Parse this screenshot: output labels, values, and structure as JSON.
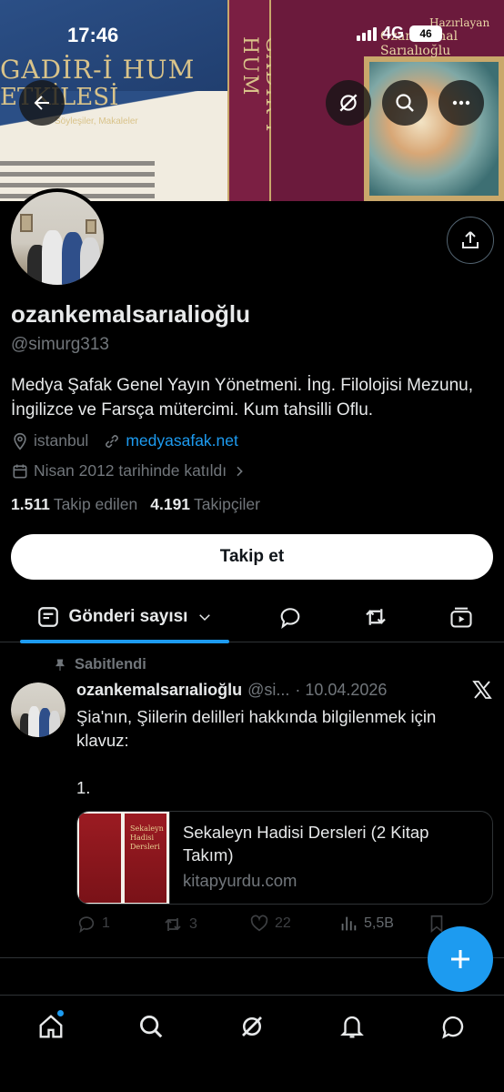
{
  "status_bar": {
    "time": "17:46",
    "network": "4G",
    "battery": "46"
  },
  "banner": {
    "title_line1": "GADİR-İ HUM",
    "title_line2": "ETKİLESİ",
    "subtitle": "Söyleşiler, Makaleler",
    "spine_text": "GADİR-İ HUM",
    "hazirlayan": "Hazırlayan",
    "editor": "Ozan Kemal Sarıalıoğlu"
  },
  "profile": {
    "name": "ozankemalsarıalioğlu",
    "handle": "@simurg313",
    "bio": "Medya Şafak Genel Yayın Yönetmeni. İng. Filolojisi Mezunu, İngilizce ve Farsça mütercimi. Kum tahsilli Oflu.",
    "location": "istanbul",
    "website": "medyasafak.net",
    "joined": "Nisan 2012 tarihinde katıldı",
    "following_count": "1.511",
    "following_label": "Takip edilen",
    "followers_count": "4.191",
    "followers_label": "Takipçiler",
    "follow_button": "Takip et"
  },
  "tabs": {
    "active_label": "Gönderi sayısı"
  },
  "post": {
    "pinned_label": "Sabitlendi",
    "author": "ozankemalsarıalioğlu",
    "handle": "@si...",
    "date": "· 10.04.2026",
    "text": "Şia'nın, Şiilerin delilleri hakkında bilgilenmek için klavuz:\n\n1.",
    "card_title": "Sekaleyn Hadisi Dersleri (2 Kitap Takım)",
    "card_domain": "kitapyurdu.com",
    "book_title": "Sekaleyn Hadisi Dersleri",
    "replies": "1",
    "reposts": "3",
    "likes": "22",
    "views": "5,5B"
  },
  "colors": {
    "accent": "#1d9bf0",
    "background": "#000000",
    "muted": "#71767b",
    "text": "#e7e9ea"
  }
}
